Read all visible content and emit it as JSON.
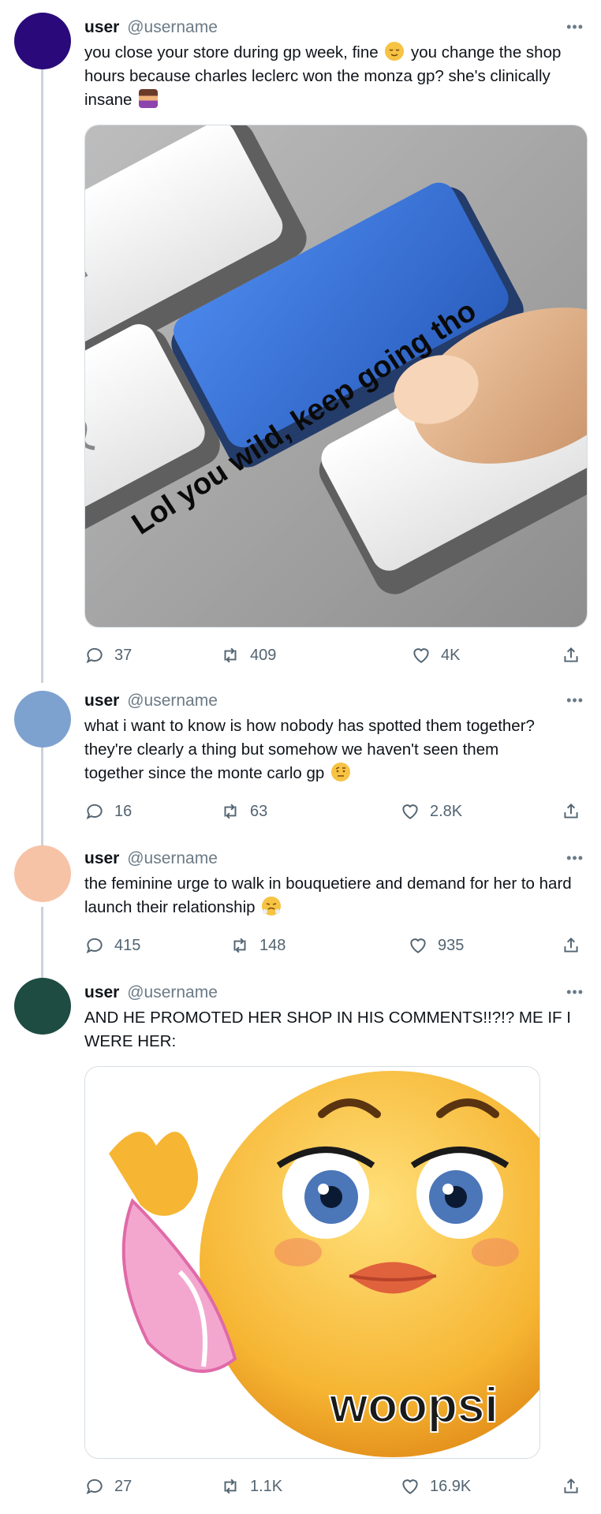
{
  "tweets": [
    {
      "name": "user",
      "handle": "@username",
      "text_before": "you close your store during gp week, fine ",
      "text_middle": " you change the shop hours because charles leclerc won the monza gp? she's clinically insane ",
      "emoji_1": "relieved-face",
      "emoji_2": "person-shrugging",
      "media": {
        "icon": "keyboard-button-meme",
        "caption": "Lol you wild, keep going tho"
      },
      "replies": "37",
      "retweets": "409",
      "likes": "4K"
    },
    {
      "name": "user",
      "handle": "@username",
      "text": "what i want to know is how nobody has spotted them together? they're clearly a thing but somehow we haven't seen them together since the monte carlo gp ",
      "emoji": "face-with-raised-eyebrow",
      "replies": "16",
      "retweets": "63",
      "likes": "2.8K"
    },
    {
      "name": "user",
      "handle": "@username",
      "text": "the feminine urge to walk in bouquetiere and demand for her to hard launch their relationship ",
      "emoji": "face-with-steam",
      "replies": "415",
      "retweets": "148",
      "likes": "935"
    },
    {
      "name": "user",
      "handle": "@username",
      "text": "AND HE PROMOTED HER SHOP IN HIS COMMENTS!!?!? ME IF I WERE HER:",
      "media": {
        "icon": "flirty-emoji-meme",
        "caption": "woopsi"
      },
      "replies": "27",
      "retweets": "1.1K",
      "likes": "16.9K"
    }
  ],
  "colors": {
    "avatar_1": "#2a0a7a",
    "avatar_2": "#7ea2d0",
    "avatar_3": "#f7c3a7",
    "avatar_4": "#1e4c43",
    "key_blue": "#3a73d8",
    "emoji_yellow": "#f6b533"
  }
}
